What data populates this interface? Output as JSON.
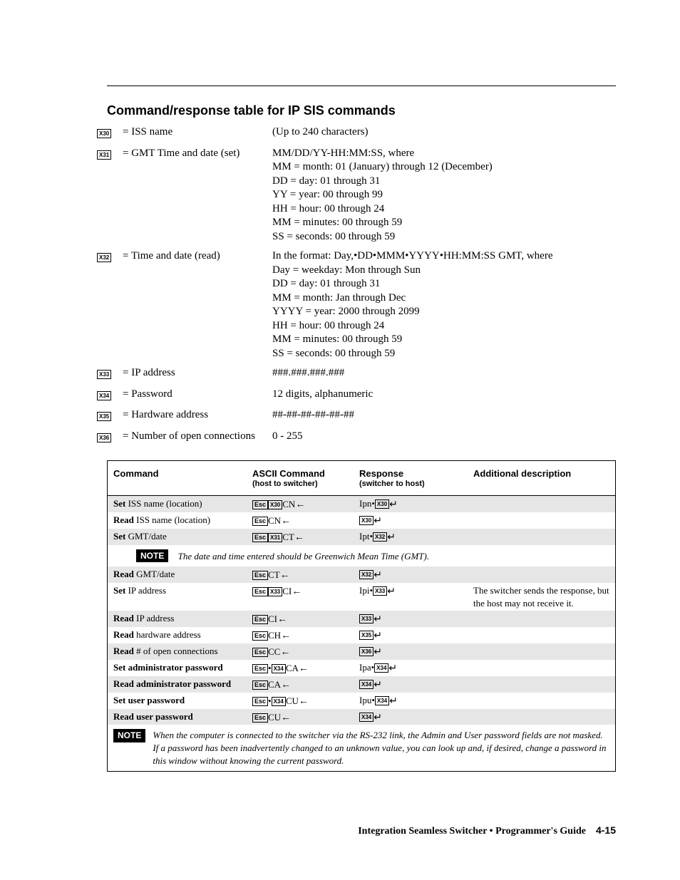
{
  "section_title": "Command/response table for IP SIS commands",
  "vars": [
    {
      "token": "X30",
      "label": "= ISS name",
      "desc": "(Up to 240 characters)"
    },
    {
      "token": "X31",
      "label": "= GMT Time and date (set)",
      "desc": "MM/DD/YY-HH:MM:SS, where\nMM = month: 01 (January) through 12 (December)\nDD = day: 01 through 31\nYY = year: 00 through 99\nHH = hour: 00 through 24\nMM = minutes: 00 through 59\nSS = seconds: 00 through 59"
    },
    {
      "token": "X32",
      "label": "= Time and date (read)",
      "desc": "In the format: Day,•DD•MMM•YYYY•HH:MM:SS GMT, where\nDay = weekday: Mon through Sun\nDD = day: 01 through 31\nMM = month: Jan through Dec\nYYYY = year: 2000 through 2099\nHH = hour: 00 through 24\nMM = minutes: 00 through 59\nSS = seconds: 00 through 59"
    },
    {
      "token": "X33",
      "label": "= IP address",
      "desc": "###.###.###.###"
    },
    {
      "token": "X34",
      "label": "= Password",
      "desc": "12 digits, alphanumeric"
    },
    {
      "token": "X35",
      "label": "= Hardware address",
      "desc": "##-##-##-##-##-##"
    },
    {
      "token": "X36",
      "label": "= Number of open connections",
      "desc": "0 - 255"
    }
  ],
  "headers": {
    "h1": "Command",
    "h2": "ASCII Command",
    "h2s": "(host to switcher)",
    "h3": "Response",
    "h3s": "(switcher to host)",
    "h4": "Additional description"
  },
  "labels": {
    "set": "Set",
    "read": "Read",
    "iss_name": " ISS name (location)",
    "gmt_date": " GMT/date",
    "ip_addr": " IP address",
    "hw_addr": " hardware address",
    "open_conn": " # of open connections",
    "set_admin_pw": "Set administrator password",
    "read_admin_pw": "Read administrator password",
    "set_user_pw": "Set user password",
    "read_user_pw": "Read user password"
  },
  "note_badge": "NOTE",
  "note1": "The date and time entered should be Greenwich Mean Time (GMT).",
  "note2": "When the computer is connected to the switcher via the RS-232 link, the Admin and User password fields are not masked.  If a password has been inadvertently changed to an unknown value, you can look up and, if desired, change a password in this window without knowing the current password.",
  "ascii": {
    "esc": "Esc",
    "cn": "CN",
    "ct": "CT",
    "ci": "CI",
    "ch": "CH",
    "cc": "CC",
    "ca": "CA",
    "cu": "CU",
    "x30": "X30",
    "x31": "X31",
    "x32": "X32",
    "x33": "X33",
    "x34": "X34",
    "x35": "X35",
    "x36": "X36"
  },
  "resp": {
    "ipn": "Ipn",
    "ipt": "Ipt",
    "ipi": "Ipi",
    "ipa": "Ipa",
    "ipu": "Ipu"
  },
  "extra": {
    "ip_note": "The switcher sends the response, but the host may not receive it."
  },
  "footer": {
    "text": "Integration Seamless Switcher • Programmer's Guide",
    "page": "4-15"
  }
}
